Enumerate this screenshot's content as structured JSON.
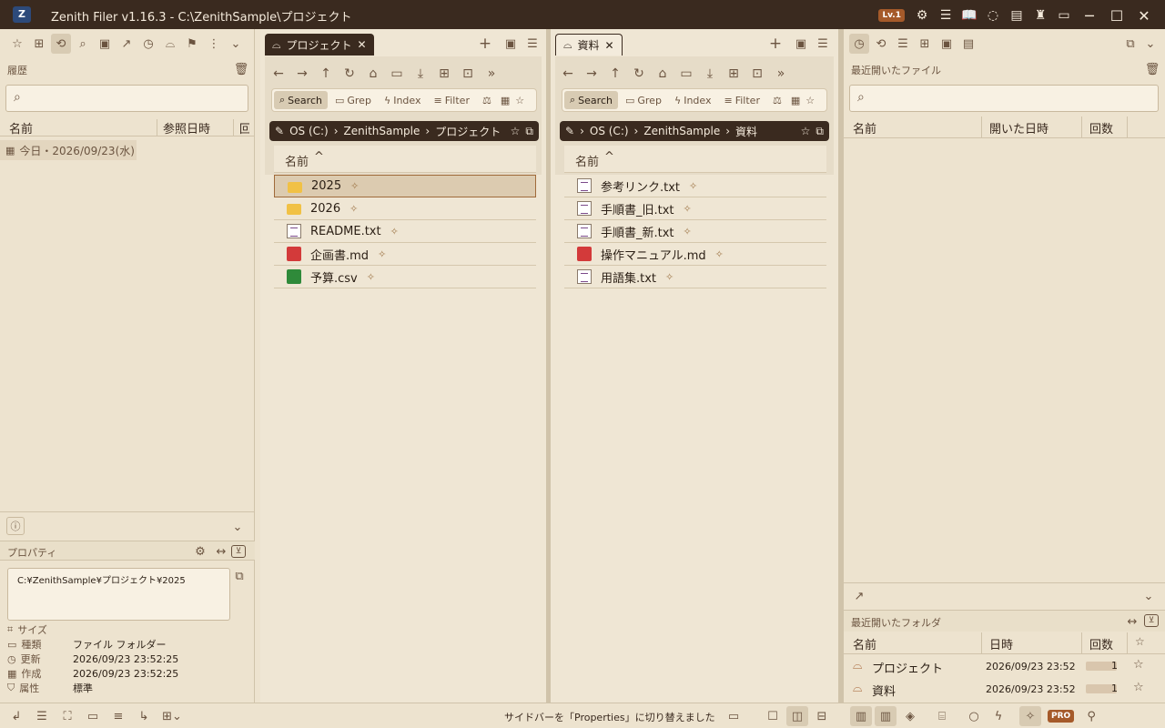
{
  "titlebar": {
    "app_title": "Zenith Filer v1.16.3 - C:\\ZenithSample\\プロジェクト",
    "level_badge": "Lv.1",
    "app_icon": "Z"
  },
  "left_sidebar": {
    "section_title": "履歴",
    "search_placeholder": "",
    "columns": [
      "名前",
      "参照日時",
      "回"
    ],
    "group_label": "今日・2026/09/23(水)"
  },
  "properties": {
    "title": "プロパティ",
    "path": "C:¥ZenithSample¥プロジェクト¥2025",
    "rows": [
      {
        "key": "サイズ",
        "value": ""
      },
      {
        "key": "種類",
        "value": "ファイル フォルダー"
      },
      {
        "key": "更新",
        "value": "2026/09/23 23:52:25"
      },
      {
        "key": "作成",
        "value": "2026/09/23 23:52:25"
      },
      {
        "key": "属性",
        "value": "標準"
      }
    ]
  },
  "pane_left": {
    "tab_label": "プロジェクト",
    "tools": [
      "Search",
      "Grep",
      "Index",
      "Filter"
    ],
    "breadcrumb": [
      "OS (C:)",
      "ZenithSample",
      "プロジェクト"
    ],
    "column_name": "名前",
    "files": [
      {
        "name": "2025",
        "type": "folder"
      },
      {
        "name": "2026",
        "type": "folder"
      },
      {
        "name": "README.txt",
        "type": "txt"
      },
      {
        "name": "企画書.md",
        "type": "md"
      },
      {
        "name": "予算.csv",
        "type": "csv"
      }
    ]
  },
  "pane_right": {
    "tab_label": "資料",
    "tools": [
      "Search",
      "Grep",
      "Index",
      "Filter"
    ],
    "breadcrumb": [
      "OS (C:)",
      "ZenithSample",
      "資料"
    ],
    "column_name": "名前",
    "files": [
      {
        "name": "参考リンク.txt",
        "type": "txt"
      },
      {
        "name": "手順書_旧.txt",
        "type": "txt"
      },
      {
        "name": "手順書_新.txt",
        "type": "txt"
      },
      {
        "name": "操作マニュアル.md",
        "type": "md"
      },
      {
        "name": "用語集.txt",
        "type": "txt"
      }
    ]
  },
  "right_sidebar": {
    "recent_files_title": "最近開いたファイル",
    "recent_files_columns": [
      "名前",
      "開いた日時",
      "回数"
    ],
    "recent_folders_title": "最近開いたフォルダ",
    "recent_folders_columns": [
      "名前",
      "日時",
      "回数"
    ],
    "recent_folders": [
      {
        "name": "プロジェクト",
        "date": "2026/09/23 23:52",
        "count": "1",
        "count_fraction": 0.85
      },
      {
        "name": "資料",
        "date": "2026/09/23 23:52",
        "count": "1",
        "count_fraction": 0.85
      }
    ]
  },
  "statusbar": {
    "message": "サイドバーを「Properties」に切り替えました",
    "pro_badge": "PRO"
  },
  "colors": {
    "titlebar_bg": "#3a2a1f",
    "panel_bg": "#ede3cf",
    "accent": "#a55a2a"
  }
}
